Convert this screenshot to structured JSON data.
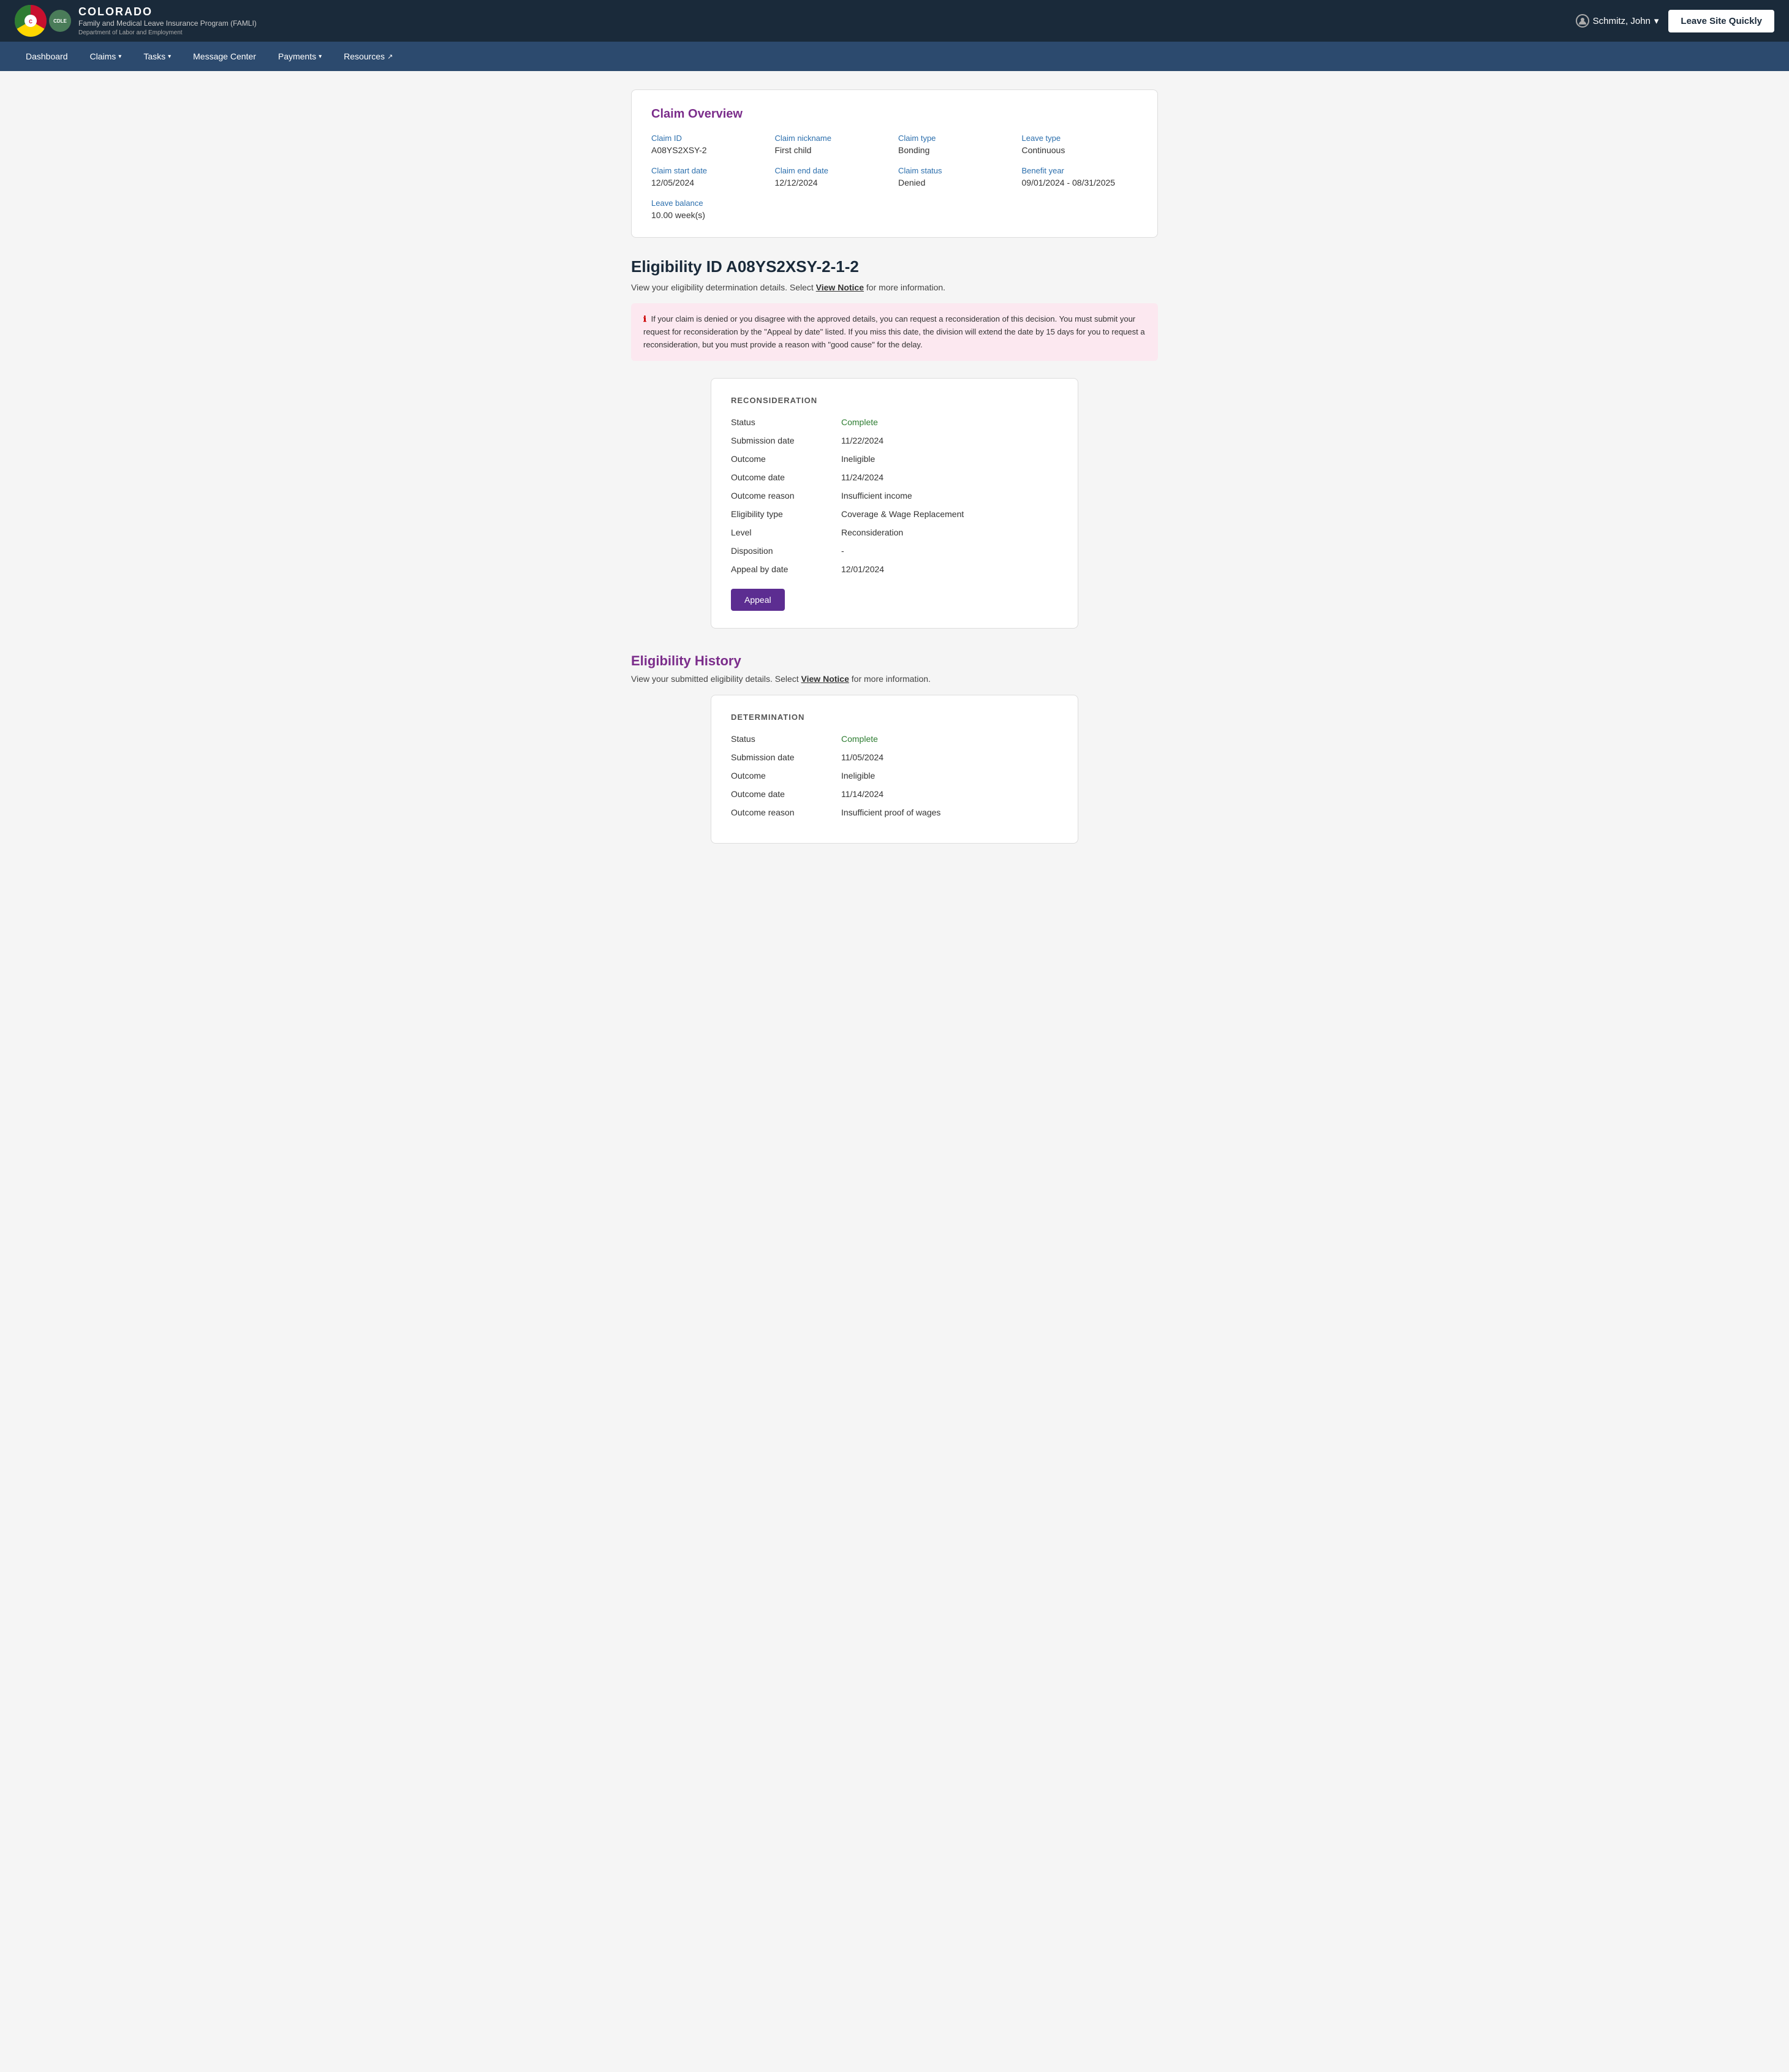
{
  "header": {
    "state_name": "COLORADO",
    "program_name": "Family and Medical Leave Insurance Program (FAMLI)",
    "dept_name": "Department of Labor and Employment",
    "user_name": "Schmitz, John",
    "leave_site_label": "Leave Site Quickly"
  },
  "nav": {
    "items": [
      {
        "label": "Dashboard",
        "has_dropdown": false,
        "external": false
      },
      {
        "label": "Claims",
        "has_dropdown": true,
        "external": false
      },
      {
        "label": "Tasks",
        "has_dropdown": true,
        "external": false
      },
      {
        "label": "Message Center",
        "has_dropdown": false,
        "external": false
      },
      {
        "label": "Payments",
        "has_dropdown": true,
        "external": false
      },
      {
        "label": "Resources",
        "has_dropdown": false,
        "external": true
      }
    ]
  },
  "claim_overview": {
    "title": "Claim Overview",
    "fields": [
      {
        "label": "Claim ID",
        "value": "A08YS2XSY-2"
      },
      {
        "label": "Claim nickname",
        "value": "First child"
      },
      {
        "label": "Claim type",
        "value": "Bonding"
      },
      {
        "label": "Leave type",
        "value": "Continuous"
      },
      {
        "label": "Claim start date",
        "value": "12/05/2024"
      },
      {
        "label": "Claim end date",
        "value": "12/12/2024"
      },
      {
        "label": "Claim status",
        "value": "Denied"
      },
      {
        "label": "Benefit year",
        "value": "09/01/2024 - 08/31/2025"
      },
      {
        "label": "Leave balance",
        "value": "10.00 week(s)"
      }
    ]
  },
  "eligibility_section": {
    "heading": "Eligibility ID A08YS2XSY-2-1-2",
    "subtext": "View your eligibility determination details. Select",
    "view_notice_label": "View Notice",
    "subtext_end": "for more information.",
    "info_box_text": "If your claim is denied or you disagree with the approved details, you can request a reconsideration of this decision. You must submit your request for reconsideration by the \"Appeal by date\" listed. If you miss this date, the division will extend the date by 15 days for you to request a reconsideration, but you must provide a reason with \"good cause\" for the delay."
  },
  "reconsideration_card": {
    "section_title": "RECONSIDERATION",
    "fields": [
      {
        "label": "Status",
        "value": "Complete",
        "is_complete": true
      },
      {
        "label": "Submission date",
        "value": "11/22/2024"
      },
      {
        "label": "Outcome",
        "value": "Ineligible"
      },
      {
        "label": "Outcome date",
        "value": "11/24/2024"
      },
      {
        "label": "Outcome reason",
        "value": "Insufficient income"
      },
      {
        "label": "Eligibility type",
        "value": "Coverage & Wage Replacement"
      },
      {
        "label": "Level",
        "value": "Reconsideration"
      },
      {
        "label": "Disposition",
        "value": "-"
      },
      {
        "label": "Appeal by date",
        "value": "12/01/2024"
      }
    ],
    "appeal_button_label": "Appeal"
  },
  "eligibility_history": {
    "title": "Eligibility History",
    "subtext": "View your submitted eligibility details. Select",
    "view_notice_label": "View Notice",
    "subtext_end": "for more information."
  },
  "determination_card": {
    "section_title": "DETERMINATION",
    "fields": [
      {
        "label": "Status",
        "value": "Complete",
        "is_complete": true
      },
      {
        "label": "Submission date",
        "value": "11/05/2024"
      },
      {
        "label": "Outcome",
        "value": "Ineligible"
      },
      {
        "label": "Outcome date",
        "value": "11/14/2024"
      },
      {
        "label": "Outcome reason",
        "value": "Insufficient proof of wages"
      }
    ]
  }
}
